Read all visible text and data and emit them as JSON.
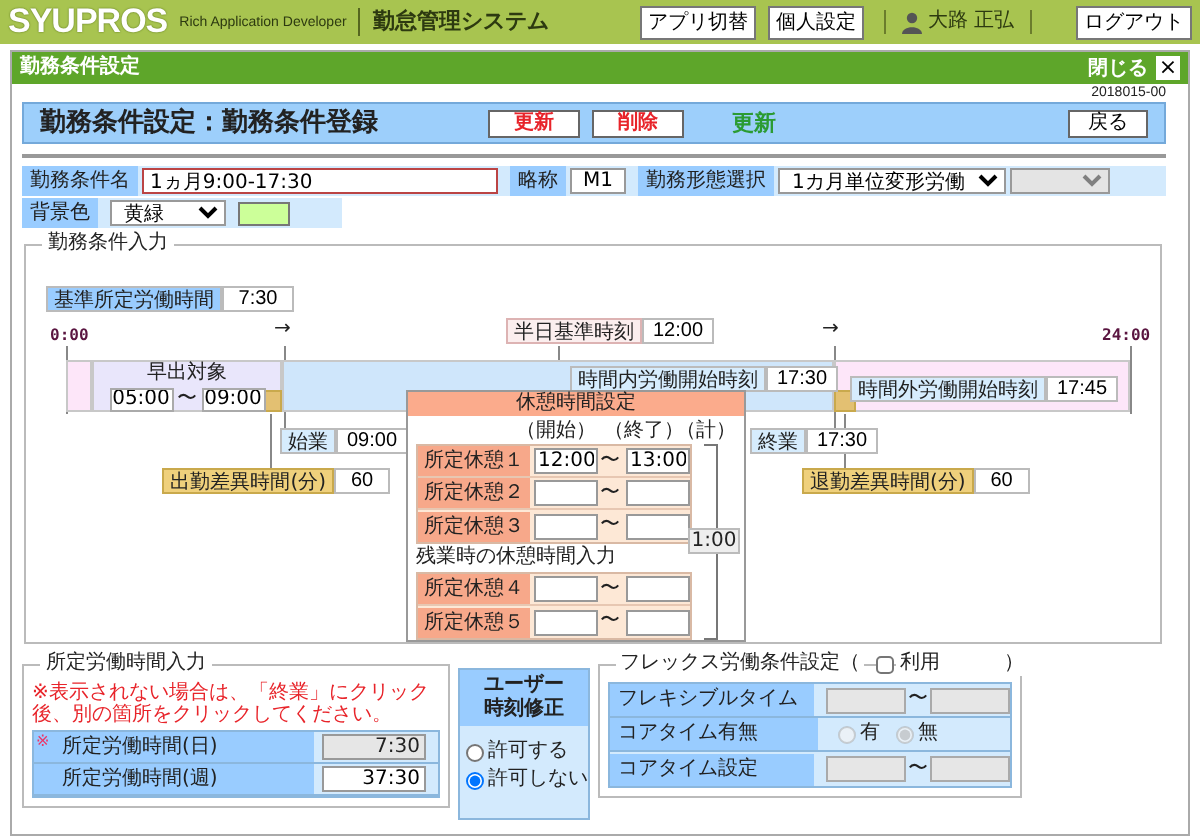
{
  "topbar": {
    "logo": "SYUPROS",
    "tagline": "Rich Application Developer",
    "system": "勤怠管理システム",
    "buttons": [
      "アプリ切替",
      "個人設定"
    ],
    "user": "大路 正弘",
    "logout": "ログアウト"
  },
  "window": {
    "title": "勤務条件設定",
    "close": "閉じる",
    "close_glyph": "×"
  },
  "date": "2018015-00",
  "header": {
    "title": "勤務条件設定：勤務条件登録",
    "buttons": [
      {
        "label": "更新",
        "kind": "danger"
      },
      {
        "label": "削除",
        "kind": "danger"
      }
    ],
    "mode": "更新",
    "back": "戻る"
  },
  "form": {
    "name": {
      "label": "勤務条件名",
      "value": "1ヵ月9:00-17:30"
    },
    "short": {
      "label": "略称",
      "value": "M1"
    },
    "type": {
      "label": "勤務形態選択",
      "value": "1カ月単位変形労働"
    },
    "subtype": {
      "disabled": true
    },
    "background": {
      "label": "背景色",
      "value": "黄緑",
      "color": "#ccff99"
    }
  },
  "conditions": {
    "legend": "勤務条件入力",
    "base": {
      "label": "基準所定労働時間",
      "value": "7:30"
    },
    "start_label": "0:00",
    "end_label": "24:00",
    "arrows": [
      "→",
      "→"
    ],
    "half": {
      "label": "半日基準時刻",
      "value": "12:00"
    },
    "early": {
      "label": "早出対象",
      "from": "05:00",
      "sep": "〜",
      "to": "09:00"
    },
    "in_start": {
      "label": "時間内労働開始時刻",
      "value": "17:30"
    },
    "out_start": {
      "label": "時間外労働開始時刻",
      "value": "17:45"
    },
    "begin": {
      "label": "始業",
      "value": "09:00"
    },
    "late_in": {
      "label": "出勤差異時間(分)",
      "value": "60"
    },
    "end": {
      "label": "終業",
      "value": "17:30"
    },
    "late_out": {
      "label": "退勤差異時間(分)",
      "value": "60"
    },
    "breaks": {
      "title": "休憩時間設定",
      "col_start": "（開始）",
      "col_end": "（終了）",
      "col_total": "（計）",
      "rows": [
        {
          "label": "所定休憩１",
          "from": "12:00",
          "sep": "〜",
          "to": "13:00"
        },
        {
          "label": "所定休憩２",
          "sep": "〜"
        },
        {
          "label": "所定休憩３",
          "sep": "〜"
        }
      ],
      "overtime_title": "残業時の休憩時間入力",
      "overtime_rows": [
        {
          "label": "所定休憩４",
          "sep": "〜"
        },
        {
          "label": "所定休憩５",
          "sep": "〜"
        }
      ],
      "total": "1:00"
    }
  },
  "hours": {
    "legend": "所定労働時間入力",
    "note": "※表示されない場合は、「終業」にクリック後、別の箇所をクリックしてください。",
    "mark": "※",
    "rows": [
      {
        "label": "所定労働時間(日)",
        "value": "7:30",
        "disabled": true
      },
      {
        "label": "所定労働時間(週)",
        "value": "37:30",
        "disabled": false
      }
    ]
  },
  "user_fix": {
    "lines": [
      "ユーザー",
      "時刻修正"
    ],
    "options": [
      {
        "label": "許可する",
        "selected": false
      },
      {
        "label": "許可しない",
        "selected": true
      }
    ]
  },
  "flex": {
    "legend_pre": "フレックス労働条件設定（",
    "use": {
      "label": "利用",
      "checked": false
    },
    "legend_post": "）",
    "rows": [
      {
        "kind": "range",
        "label": "フレキシブルタイム",
        "sep": "〜"
      },
      {
        "kind": "radio",
        "label": "コアタイム有無",
        "options": [
          {
            "label": "有",
            "selected": false
          },
          {
            "label": "無",
            "selected": true
          }
        ]
      },
      {
        "kind": "range",
        "label": "コアタイム設定",
        "sep": "〜"
      }
    ]
  }
}
